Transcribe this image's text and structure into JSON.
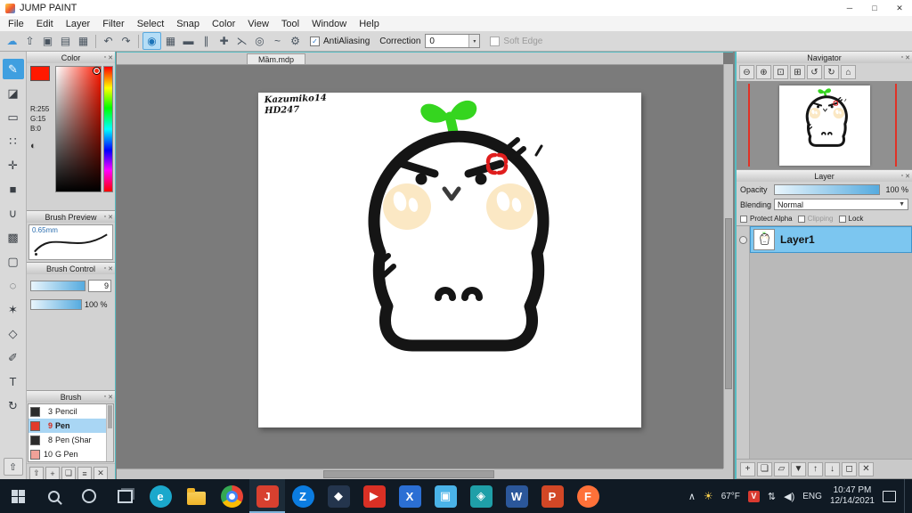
{
  "titlebar": {
    "title": "JUMP PAINT",
    "minimize_glyph": "─",
    "maximize_glyph": "□",
    "close_glyph": "✕"
  },
  "ui": {
    "panel_collapse_glyph": "▫",
    "panel_close_glyph": "✕"
  },
  "menubar": {
    "items": [
      "File",
      "Edit",
      "Layer",
      "Filter",
      "Select",
      "Snap",
      "Color",
      "View",
      "Tool",
      "Window",
      "Help"
    ]
  },
  "toolbar": {
    "file_icons": [
      {
        "name": "cloud-save-icon",
        "glyph": "☁"
      },
      {
        "name": "export-icon",
        "glyph": "⇧"
      },
      {
        "name": "open-image-icon",
        "glyph": "▣"
      },
      {
        "name": "save-image-icon",
        "glyph": "▤"
      },
      {
        "name": "grid-view-icon",
        "glyph": "▦"
      }
    ],
    "undo_glyph": "↶",
    "redo_glyph": "↷",
    "snap_icons": [
      {
        "name": "brush-mode-icon",
        "glyph": "◉"
      },
      {
        "name": "grid-snap-icon",
        "glyph": "▦"
      },
      {
        "name": "snap-off-icon",
        "glyph": "▬"
      },
      {
        "name": "parallel-snap-icon",
        "glyph": "∥"
      },
      {
        "name": "crisscross-snap-icon",
        "glyph": "✚"
      },
      {
        "name": "vanishing-point-snap-icon",
        "glyph": "⋋"
      },
      {
        "name": "concentric-snap-icon",
        "glyph": "◎"
      },
      {
        "name": "curve-snap-icon",
        "glyph": "~"
      },
      {
        "name": "snap-settings-icon",
        "glyph": "⚙"
      }
    ],
    "antialiasing_label": "AntiAliasing",
    "check_glyph": "✓",
    "correction_label": "Correction",
    "correction_value": "0",
    "spinner_glyph": "▾",
    "soft_edge_label": "Soft Edge"
  },
  "tools": [
    {
      "name": "brush-tool",
      "glyph": "✎"
    },
    {
      "name": "eraser-tool",
      "glyph": "◪"
    },
    {
      "name": "dot-pen-tool",
      "glyph": "▭"
    },
    {
      "name": "pattern-tool",
      "glyph": "∷"
    },
    {
      "name": "move-tool",
      "glyph": "✛"
    },
    {
      "name": "fill-rect-tool",
      "glyph": "■"
    },
    {
      "name": "bucket-tool",
      "glyph": "∪"
    },
    {
      "name": "gradient-tool",
      "glyph": "▩"
    },
    {
      "name": "select-rect-tool",
      "glyph": "▢"
    },
    {
      "name": "lasso-select-tool",
      "glyph": "◌"
    },
    {
      "name": "magic-wand-tool",
      "glyph": "✶"
    },
    {
      "name": "polygon-select-tool",
      "glyph": "◇"
    },
    {
      "name": "select-pen-tool",
      "glyph": "✐"
    },
    {
      "name": "text-tool",
      "glyph": "T"
    },
    {
      "name": "hand-rotate-tool",
      "glyph": "↻"
    }
  ],
  "tool_bottom_glyph": "⇧",
  "color_panel": {
    "title": "Color",
    "foreground": "#ff1900",
    "r": "R:255",
    "g": "G:15",
    "b": "B:0",
    "palette_glyph": "◐"
  },
  "brush_preview": {
    "title": "Brush Preview",
    "size": "0.65mm"
  },
  "brush_control": {
    "title": "Brush Control",
    "size_value": "9",
    "opacity_value": "100 %"
  },
  "brush_panel": {
    "title": "Brush",
    "items": [
      {
        "size": "3",
        "name": "Pencil",
        "color": "#2b2b2b"
      },
      {
        "size": "9",
        "name": "Pen",
        "color": "#e23a2a"
      },
      {
        "size": "8",
        "name": "Pen (Shar",
        "color": "#2b2b2b"
      },
      {
        "size": "10",
        "name": "G Pen",
        "color": "#f0a198"
      }
    ],
    "buttons": [
      {
        "name": "expand-panel-icon",
        "glyph": "⇧"
      },
      {
        "name": "add-brush-icon",
        "glyph": "+"
      },
      {
        "name": "duplicate-brush-icon",
        "glyph": "❏"
      },
      {
        "name": "brush-settings-icon",
        "glyph": "≡"
      },
      {
        "name": "delete-brush-icon",
        "glyph": "✕"
      }
    ]
  },
  "canvas": {
    "tab": "Mầm.mdp",
    "signature_line1": "Kazumiko14",
    "signature_line2": "HD247"
  },
  "navigator": {
    "title": "Navigator",
    "buttons": [
      {
        "name": "zoom-out-icon",
        "glyph": "⊖"
      },
      {
        "name": "zoom-in-icon",
        "glyph": "⊕"
      },
      {
        "name": "fit-window-icon",
        "glyph": "⊡"
      },
      {
        "name": "actual-size-icon",
        "glyph": "⊞"
      },
      {
        "name": "rotate-left-icon",
        "glyph": "↺"
      },
      {
        "name": "rotate-right-icon",
        "glyph": "↻"
      },
      {
        "name": "reset-view-icon",
        "glyph": "⌂"
      }
    ]
  },
  "layer_panel": {
    "title": "Layer",
    "opacity_label": "Opacity",
    "opacity_value": "100 %",
    "blending_label": "Blending",
    "blending_value": "Normal",
    "blend_arrow_glyph": "▼",
    "protect_alpha_label": "Protect Alpha",
    "clipping_label": "Clipping",
    "lock_label": "Lock",
    "layers": [
      {
        "name": "Layer1"
      }
    ],
    "buttons": [
      {
        "name": "add-layer-icon",
        "glyph": "+"
      },
      {
        "name": "duplicate-layer-icon",
        "glyph": "❏"
      },
      {
        "name": "layer-folder-icon",
        "glyph": "▱"
      },
      {
        "name": "merge-down-icon",
        "glyph": "▼"
      },
      {
        "name": "move-layer-up-icon",
        "glyph": "↑"
      },
      {
        "name": "move-layer-down-icon",
        "glyph": "↓"
      },
      {
        "name": "clear-layer-icon",
        "glyph": "◻"
      },
      {
        "name": "delete-layer-icon",
        "glyph": "✕"
      }
    ]
  },
  "taskbar": {
    "apps": [
      {
        "name": "edge",
        "glyph": "e",
        "color": "#1ba8cc"
      },
      {
        "name": "file-explorer",
        "glyph": "",
        "color": "#f0b429"
      },
      {
        "name": "chrome",
        "glyph": "",
        "color": "#4285f4"
      },
      {
        "name": "jump-paint",
        "glyph": "J",
        "color": "#d8402f"
      },
      {
        "name": "zalo",
        "glyph": "Z",
        "color": "#0b7ce0"
      },
      {
        "name": "app-dark",
        "glyph": "◆",
        "color": "#24354d"
      },
      {
        "name": "media-player",
        "glyph": "▶",
        "color": "#d93025"
      },
      {
        "name": "app-x",
        "glyph": "X",
        "color": "#2b6fd4"
      },
      {
        "name": "photos",
        "glyph": "▣",
        "color": "#4ab3e8"
      },
      {
        "name": "app-teal",
        "glyph": "◈",
        "color": "#1f9fa8"
      },
      {
        "name": "word",
        "glyph": "W",
        "color": "#2b579a"
      },
      {
        "name": "powerpoint",
        "glyph": "P",
        "color": "#d24726"
      },
      {
        "name": "firefox",
        "glyph": "F",
        "color": "#ff7139"
      }
    ],
    "tray": {
      "hidden_glyph": "∧",
      "sun_glyph": "☀",
      "weather": "67°F",
      "v_label": "V",
      "network_glyph": "⇅",
      "speaker_glyph": "◀)",
      "lang": "ENG",
      "time": "10:47 PM",
      "date": "12/14/2021"
    }
  }
}
